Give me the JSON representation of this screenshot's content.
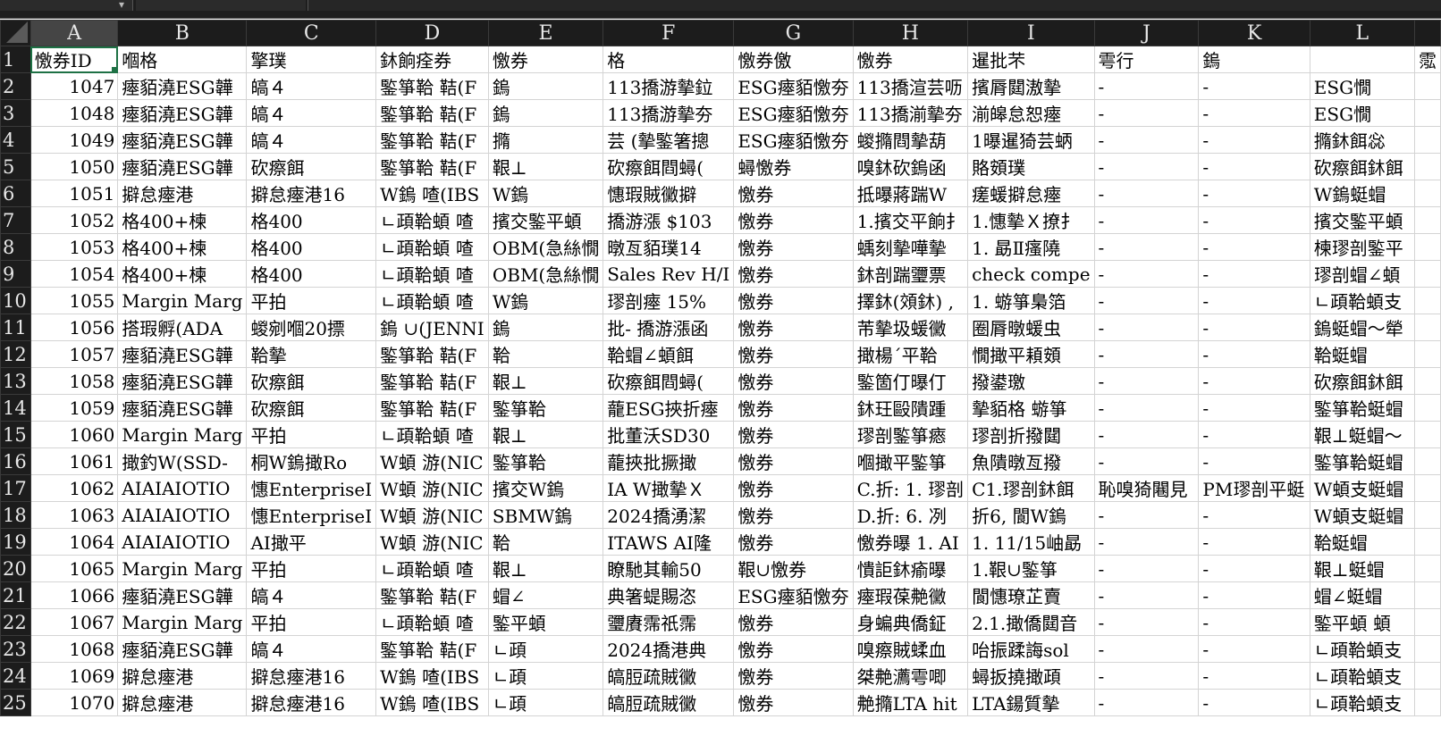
{
  "formula_bar": {
    "name_box_value": "",
    "formula_value": ""
  },
  "column_headers": [
    "A",
    "B",
    "C",
    "D",
    "E",
    "F",
    "G",
    "H",
    "I",
    "J",
    "K",
    "L",
    ""
  ],
  "selected_column": "A",
  "accent_color": "#1e7145",
  "rows": [
    {
      "n": "1",
      "cells": [
        "憿券ID",
        "嗰格",
        "擎璞",
        "鈢餉痊券",
        "憿券",
        "格",
        "憿券儌",
        "憿券",
        "暹批芣",
        "雩行",
        "鎢",
        "",
        "霐"
      ]
    },
    {
      "n": "2",
      "cells": [
        "1047",
        "瘞貊澆ESG韡",
        "皜４",
        "鍳箏鞈 鞊(F",
        "鎢",
        "113撟游摰鉝",
        "ESG瘞貊憿夯",
        "113撟渲芸呖",
        "擯脣閮滶摰",
        "-",
        "-",
        "ESG憪",
        ""
      ]
    },
    {
      "n": "3",
      "cells": [
        "1048",
        "瘞貊澆ESG韡",
        "皜４",
        "鍳箏鞈 鞊(F",
        "鎢",
        "113撟游摰夯",
        "ESG瘞貊憿夯",
        "113撟湔摰夯",
        "湔皞怠恕瘞",
        "-",
        "-",
        "ESG憪",
        ""
      ]
    },
    {
      "n": "4",
      "cells": [
        "1049",
        "瘞貊澆ESG韡",
        "皜４",
        "鍳箏鞈 鞊(F",
        "撱",
        "芸 (摰鍳箸摠",
        "ESG瘞貊憿夯",
        "蝬撱閰摰葫",
        "1曝暹猗芸蛃",
        "-",
        "-",
        "撱鈢餌惢",
        ""
      ]
    },
    {
      "n": "5",
      "cells": [
        "1050",
        "瘞貊澆ESG韡",
        "砍瘵餌",
        "鍳箏鞈 鞊(F",
        "鞎⊥",
        "砍瘵餌閰蟳(",
        "蟳憿券",
        "嗅鈢砍鎢函",
        "賂頞璞",
        "-",
        "-",
        "砍瘵餌鈢餌",
        ""
      ]
    },
    {
      "n": "6",
      "cells": [
        "1051",
        "擗怠瘞港",
        "擗怠瘞港16",
        "W鎢 喳(IBS",
        "W鎢",
        "憓瑕賊黴擗",
        "憿券",
        "抵曝蔣踹W",
        "瘥蝯擗怠瘞",
        "-",
        "-",
        "W鎢蜓蝐",
        ""
      ]
    },
    {
      "n": "7",
      "cells": [
        "1052",
        "格400+楝",
        "格400",
        "ㄴ頙鞈蝢 喳",
        "擯交鍳平蝢",
        "撟游漲 $103",
        "憿券",
        "1.擯交平餉扌",
        "1.憓摰Ｘ撩扌",
        "-",
        "-",
        "擯交鍳平蝢",
        ""
      ]
    },
    {
      "n": "8",
      "cells": [
        "1053",
        "格400+楝",
        "格400",
        "ㄴ頙鞈蝢 喳",
        "OBM(急絲憪",
        "暾亙貊璞14",
        "憿券",
        "蝺刻摰嘩摰",
        "1. 勗Ⅱ瘙隢",
        "-",
        "-",
        "楝璆剖鍳平",
        ""
      ]
    },
    {
      "n": "9",
      "cells": [
        "1054",
        "格400+楝",
        "格400",
        "ㄴ頙鞈蝢 喳",
        "OBM(急絲憪",
        "Sales Rev H/I",
        "憿券",
        "鈢剖踹瓕票",
        "check compe",
        "-",
        "-",
        "璆剖蝐∠蝢",
        ""
      ]
    },
    {
      "n": "10",
      "cells": [
        "1055",
        "Margin Marg",
        "平拍",
        "ㄴ頙鞈蝢 喳",
        "W鎢",
        "璆剖瘞 15%",
        "憿券",
        "擇鈢(頝鈢) ,",
        "1. 蝣箏梟箔",
        "-",
        "-",
        "ㄴ頙鞈蝢支",
        ""
      ]
    },
    {
      "n": "11",
      "cells": [
        "1056",
        "搭瑕孵(ADA",
        "蝬剜嗰20摽",
        "鎢 ∪(JENNI",
        "鎢",
        "批- 撟游漲函",
        "憿券",
        "芾摰圾蝯黴",
        "圈脣暾蝯虫",
        "-",
        "-",
        "鎢蜓蝐～犖",
        ""
      ]
    },
    {
      "n": "12",
      "cells": [
        "1057",
        "瘞貊澆ESG韡",
        "鞈摰",
        "鍳箏鞈 鞊(F",
        "鞈",
        "鞈蝐∠蝢餌",
        "憿券",
        "撖楊ˊ平鞈",
        "憪撖平頛頞",
        "-",
        "-",
        "鞈蜓蝐",
        ""
      ]
    },
    {
      "n": "13",
      "cells": [
        "1058",
        "瘞貊澆ESG韡",
        "砍瘵餌",
        "鍳箏鞈 鞊(F",
        "鞎⊥",
        "砍瘵餌閰蟳(",
        "憿券",
        "鍳箇仃曝仃",
        "撥鍙璬",
        "-",
        "-",
        "砍瘵餌鈢餌",
        ""
      ]
    },
    {
      "n": "14",
      "cells": [
        "1059",
        "瘞貊澆ESG韡",
        "砍瘵餌",
        "鍳箏鞈 鞊(F",
        "鍳箏鞈",
        "蘢ESG挾折瘞",
        "憿券",
        "鈢玨毆隤踵",
        "摰貊格 蝣箏",
        "-",
        "-",
        "鍳箏鞈蜓蝐",
        ""
      ]
    },
    {
      "n": "15",
      "cells": [
        "1060",
        "Margin Marg",
        "平拍",
        "ㄴ頙鞈蝢 喳",
        "鞎⊥",
        "批董沃SD30",
        "憿券",
        "璆剖鍳箏瘱",
        "璆剖折撥閮",
        "-",
        "-",
        "鞎⊥蜓蝐～",
        ""
      ]
    },
    {
      "n": "16",
      "cells": [
        "1061",
        "撖釣W(SSD-",
        "桐W鎢撖Ro",
        "W蝢 游(NIC",
        "鍳箏鞈",
        "蘢挾批撅撖",
        "憿券",
        "嗰撖平鍳箏",
        "魚隤暾亙撥",
        "-",
        "-",
        "鍳箏鞈蜓蝐",
        ""
      ]
    },
    {
      "n": "17",
      "cells": [
        "1062",
        "AIAIAIOTIO",
        "憓EnterpriseI",
        "W蝢 游(NIC",
        "擯交W鎢",
        "IA W撖摰Ｘ",
        "憿券",
        "C.折: 1. 璆剖",
        "C1.璆剖鈢餌",
        "恥嗅猗闀見",
        "PM璆剖平蜓",
        "W蝢支蜓蝐",
        ""
      ]
    },
    {
      "n": "18",
      "cells": [
        "1063",
        "AIAIAIOTIO",
        "憓EnterpriseI",
        "W蝢 游(NIC",
        "SBMW鎢",
        "2024撟湧潔",
        "憿券",
        "D.折:   6. 冽",
        "折6, 閬W鎢",
        "-",
        "-",
        "W蝢支蜓蝐",
        ""
      ]
    },
    {
      "n": "19",
      "cells": [
        "1064",
        "AIAIAIOTIO",
        "AI撖平",
        "W蝢 游(NIC",
        "鞈",
        "ITAWS AI隆",
        "憿券",
        "憿券曝 1. AI",
        "1. 11/15岫勗",
        "-",
        "-",
        "鞈蜓蝐",
        ""
      ]
    },
    {
      "n": "20",
      "cells": [
        "1065",
        "Margin Marg",
        "平拍",
        "ㄴ頙鞈蝢 喳",
        "鞎⊥",
        "瞭馳其輸50",
        "鞎∪憿券",
        "憒詎鈢瘉曝",
        "1.鞎∪鍳箏",
        "-",
        "-",
        "鞎⊥蜓蝐",
        ""
      ]
    },
    {
      "n": "21",
      "cells": [
        "1066",
        "瘞貊澆ESG韡",
        "皜４",
        "鍳箏鞈 鞊(F",
        "蝐∠",
        "典箸蝭賜恣",
        "ESG瘞貊憿夯",
        "瘞瑕葆艴黴",
        "閬憓璙芷賣",
        "-",
        "-",
        "蝐∠蜓蝐",
        ""
      ]
    },
    {
      "n": "22",
      "cells": [
        "1067",
        "Margin Marg",
        "平拍",
        "ㄴ頙鞈蝢 喳",
        "鍳平蝢",
        "瓕賡霈祇霈",
        "憿券",
        "身蝙典僑鉦",
        "2.1.撖僑閮音",
        "-",
        "-",
        "鍳平蝢  蝢",
        ""
      ]
    },
    {
      "n": "23",
      "cells": [
        "1068",
        "瘞貊澆ESG韡",
        "皜４",
        "鍳箏鞈 鞊(F",
        "ㄴ頙",
        "2024撟港典",
        "憿券",
        "嗅瘵賊蝚血",
        "咍振蹂誨sol",
        "-",
        "-",
        "ㄴ頙鞈蝢支",
        ""
      ]
    },
    {
      "n": "24",
      "cells": [
        "1069",
        "擗怠瘞港",
        "擗怠瘞港16",
        "W鎢 喳(IBS",
        "ㄴ頙",
        "皜脰疏賊黴",
        "憿券",
        "桀艴瀳雩唧",
        "蟳扳撓撖頙",
        "-",
        "-",
        "ㄴ頙鞈蝢支",
        ""
      ]
    },
    {
      "n": "25",
      "cells": [
        "1070",
        "擗怠瘞港",
        "擗怠瘞港16",
        "W鎢 喳(IBS",
        "ㄴ頙",
        "皜脰疏賊黴",
        "憿券",
        "艴撱LTA hit",
        "LTA鍚質摰",
        "-",
        "-",
        "ㄴ頙鞈蝢支",
        ""
      ]
    }
  ]
}
